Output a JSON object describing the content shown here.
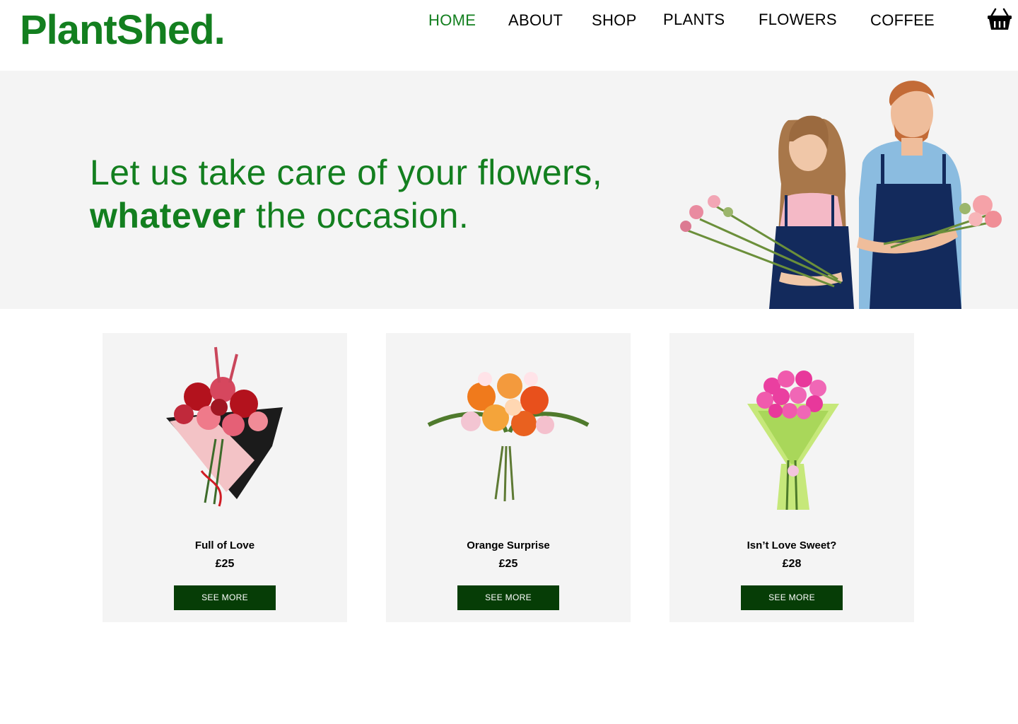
{
  "brand": {
    "name": "PlantShed.",
    "color": "#137f1f"
  },
  "nav": {
    "items": [
      {
        "label": "HOME",
        "active": true
      },
      {
        "label": "ABOUT"
      },
      {
        "label": "SHOP"
      },
      {
        "label": "PLANTS"
      },
      {
        "label": "FLOWERS"
      },
      {
        "label": "COFFEE"
      }
    ],
    "cart_icon": "basket-icon"
  },
  "hero": {
    "line1": "Let us take care of your flowers,",
    "line2_bold": "whatever",
    "line2_rest": " the occasion.",
    "image": "florists-with-bouquets"
  },
  "products": [
    {
      "name": "Full of Love",
      "price": "£25",
      "button": "SEE MORE",
      "image": "red-pink-rose-bouquet"
    },
    {
      "name": "Orange Surprise",
      "price": "£25",
      "button": "SEE MORE",
      "image": "orange-mixed-bouquet"
    },
    {
      "name": "Isn’t Love Sweet?",
      "price": "£28",
      "button": "SEE MORE",
      "image": "pink-rose-bouquet"
    }
  ],
  "colors": {
    "accent": "#137f1f",
    "button": "#063d06",
    "panel": "#f4f4f4"
  }
}
